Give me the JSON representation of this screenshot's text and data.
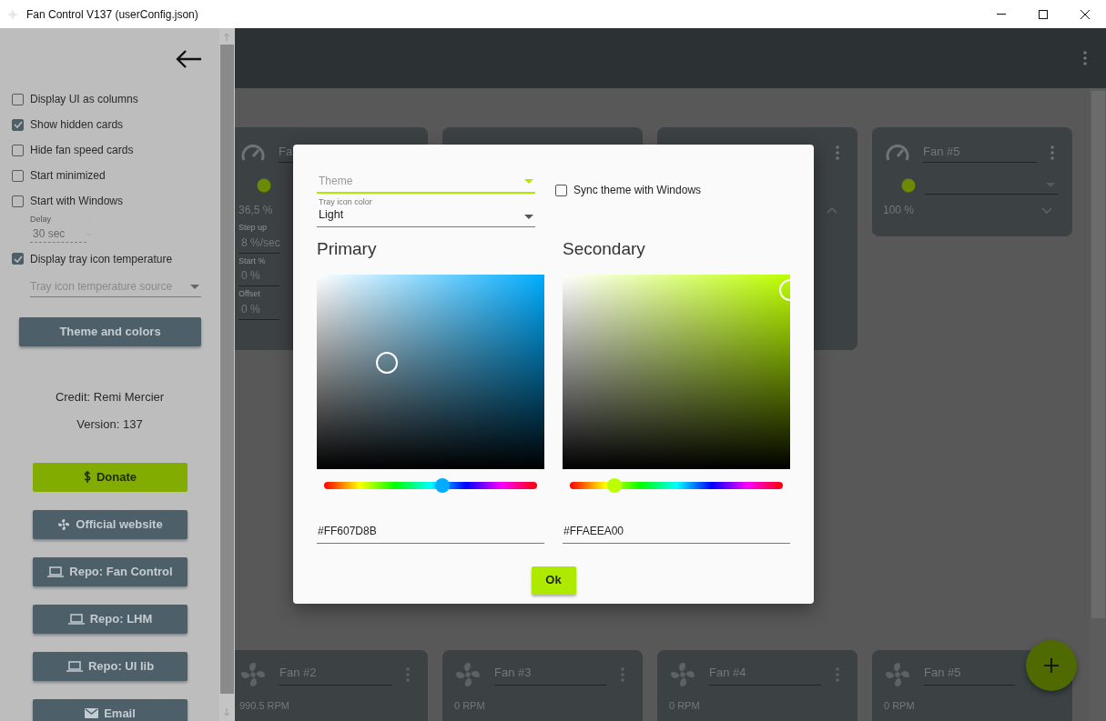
{
  "window": {
    "title": "Fan Control V137 (userConfig.json)"
  },
  "sidebar": {
    "items": [
      {
        "kind": "checkbox",
        "label": "Display UI as columns",
        "checked": false
      },
      {
        "kind": "checkbox",
        "label": "Show hidden cards",
        "checked": true
      },
      {
        "kind": "checkbox",
        "label": "Hide fan speed cards",
        "checked": false
      },
      {
        "kind": "checkbox",
        "label": "Start minimized",
        "checked": false
      },
      {
        "kind": "checkbox",
        "label": "Start with Windows",
        "checked": false
      },
      {
        "kind": "number_field",
        "label": "Delay",
        "value": "30 sec",
        "disabled": true
      },
      {
        "kind": "checkbox",
        "label": "Display tray icon temperature",
        "checked": true
      },
      {
        "kind": "dropdown",
        "placeholder": "Tray icon temperature source"
      }
    ],
    "theme_button": "Theme and colors",
    "credit": "Credit: Remi Mercier",
    "version": "Version: 137",
    "links": [
      {
        "label": "Donate",
        "kind": "donate"
      },
      {
        "label": "Official website",
        "kind": "website"
      },
      {
        "label": "Repo: Fan Control",
        "kind": "repo"
      },
      {
        "label": "Repo: LHM",
        "kind": "repo"
      },
      {
        "label": "Repo: UI lib",
        "kind": "repo"
      },
      {
        "label": "Email",
        "kind": "email"
      }
    ]
  },
  "top_cards": [
    {
      "kind": "fan",
      "title": "Fa",
      "dot": true,
      "reading": "36,5 %",
      "fields": [
        {
          "label": "Step up",
          "value": "8 %/sec"
        },
        {
          "label": "Start %",
          "value": "0 %"
        },
        {
          "label": "Offset",
          "value": "0 %"
        }
      ]
    },
    {
      "kind": "covered"
    },
    {
      "kind": "fan",
      "menu": true,
      "expanded": true
    },
    {
      "kind": "fan",
      "title": "Fan #5",
      "menu": true,
      "dot": true,
      "dropdown": true,
      "reading": "100 %",
      "expanded": false
    }
  ],
  "bottom_cards": [
    {
      "title": "Fan #2",
      "reading": "990.5 RPM"
    },
    {
      "title": "Fan #3",
      "reading": "0 RPM"
    },
    {
      "title": "Fan #4",
      "reading": "0 RPM"
    },
    {
      "title": "Fan #5",
      "reading": "0 RPM"
    }
  ],
  "dialog": {
    "theme": {
      "placeholder": "Theme"
    },
    "tray_icon_color": {
      "label": "Tray icon color",
      "value": "Light"
    },
    "sync": {
      "label": "Sync theme with Windows",
      "checked": false
    },
    "pickers": [
      {
        "title": "Primary",
        "value": "#FF607D8B"
      },
      {
        "title": "Secondary",
        "value": "#FFAEEA00"
      }
    ],
    "ok": "Ok"
  }
}
